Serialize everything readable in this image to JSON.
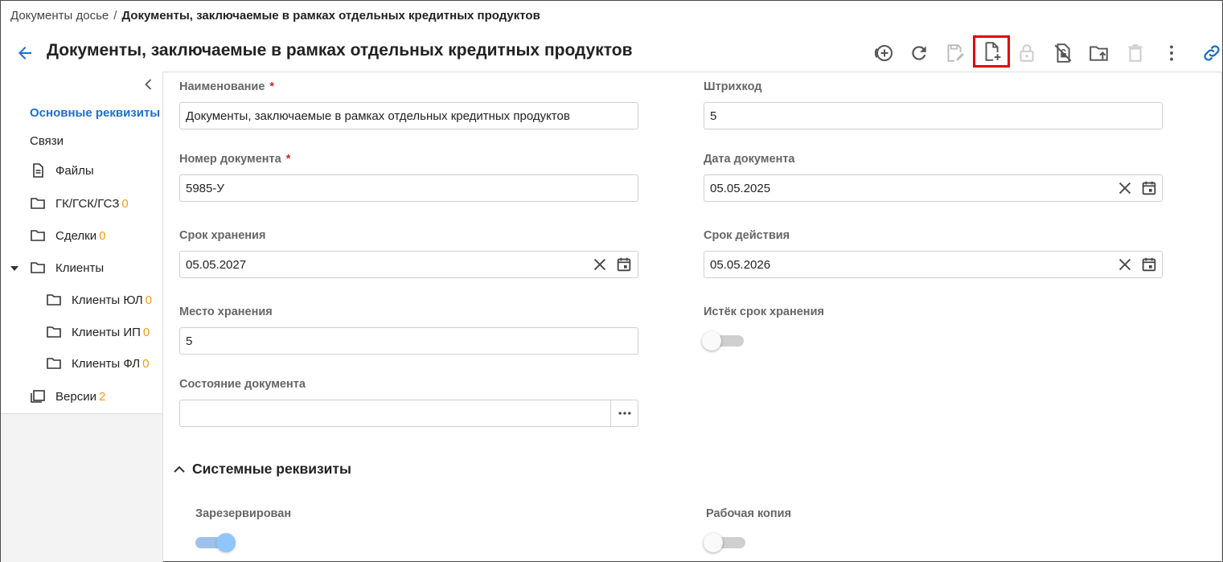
{
  "breadcrumb": {
    "parent": "Документы досье",
    "separator": "/",
    "current": "Документы, заключаемые в рамках отдельных кредитных продуктов"
  },
  "header": {
    "title": "Документы, заключаемые в рамках отдельных кредитных продуктов",
    "toolbar": [
      {
        "icon": "add-circle-icon",
        "enabled": true
      },
      {
        "icon": "refresh-icon",
        "enabled": true
      },
      {
        "icon": "save-edit-icon",
        "enabled": false
      },
      {
        "icon": "new-document-icon",
        "enabled": true,
        "highlighted": true
      },
      {
        "icon": "lock-icon",
        "enabled": false
      },
      {
        "icon": "unlock-icon",
        "enabled": true
      },
      {
        "icon": "folder-upload-icon",
        "enabled": true
      },
      {
        "icon": "delete-icon",
        "enabled": false
      },
      {
        "icon": "more-vertical-icon",
        "enabled": true
      },
      {
        "icon": "link-icon",
        "enabled": true
      }
    ]
  },
  "sidebar": {
    "items": [
      {
        "label": "Основные реквизиты",
        "active": true
      },
      {
        "label": "Связи"
      },
      {
        "label": "Файлы",
        "icon": "file-icon"
      },
      {
        "label": "ГК/ГСК/ГСЗ",
        "count": "0",
        "icon": "folder-icon"
      },
      {
        "label": "Сделки",
        "count": "0",
        "icon": "folder-icon"
      },
      {
        "label": "Клиенты",
        "icon": "folder-icon",
        "expanded": true
      },
      {
        "label": "Клиенты ЮЛ",
        "count": "0",
        "icon": "folder-icon"
      },
      {
        "label": "Клиенты ИП",
        "count": "0",
        "icon": "folder-icon"
      },
      {
        "label": "Клиенты ФЛ",
        "count": "0",
        "icon": "folder-icon"
      },
      {
        "label": "Версии",
        "count": "2",
        "icon": "versions-icon"
      }
    ]
  },
  "form": {
    "name": {
      "label": "Наименование",
      "required": "*",
      "value": "Документы, заключаемые в рамках отдельных кредитных продуктов"
    },
    "barcode": {
      "label": "Штрихкод",
      "value": "5"
    },
    "doc_number": {
      "label": "Номер документа",
      "required": "*",
      "value": "5985-У"
    },
    "doc_date": {
      "label": "Дата документа",
      "value": "05.05.2025"
    },
    "storage_term": {
      "label": "Срок хранения",
      "value": "05.05.2027"
    },
    "validity_term": {
      "label": "Срок действия",
      "value": "05.05.2026"
    },
    "storage_place": {
      "label": "Место хранения",
      "value": "5"
    },
    "storage_expired": {
      "label": "Истёк срок хранения",
      "on": false
    },
    "doc_state": {
      "label": "Состояние документа",
      "value": ""
    }
  },
  "system_section": {
    "title": "Системные реквизиты",
    "reserved": {
      "label": "Зарезервирован",
      "on": true
    },
    "working_copy": {
      "label": "Рабочая копия",
      "on": false
    }
  },
  "colors": {
    "accent": "#1a6fd1",
    "count": "#f29b11",
    "required": "#c62828",
    "highlight": "#e3000f"
  }
}
